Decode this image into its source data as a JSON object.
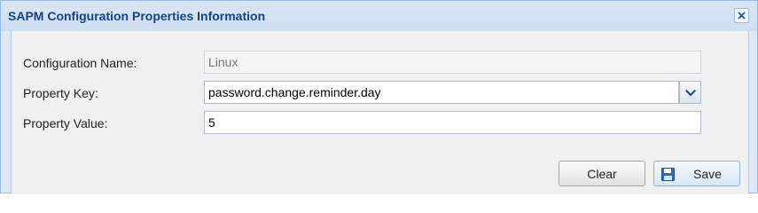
{
  "dialog": {
    "title": "SAPM Configuration Properties Information",
    "close_icon": "close-icon"
  },
  "form": {
    "config_name": {
      "label": "Configuration Name:",
      "placeholder": "Linux",
      "value": ""
    },
    "property_key": {
      "label": "Property Key:",
      "value": "password.change.reminder.day",
      "trigger_icon": "chevron-down-icon"
    },
    "property_value": {
      "label": "Property Value:",
      "value": "5"
    }
  },
  "buttons": {
    "clear_label": "Clear",
    "save_label": "Save",
    "save_icon": "floppy-disk-icon"
  },
  "colors": {
    "title_text": "#15428b",
    "dialog_border": "#99bbe8",
    "panel_background": "#f0f0f0",
    "accent": "#1f6fc5"
  }
}
